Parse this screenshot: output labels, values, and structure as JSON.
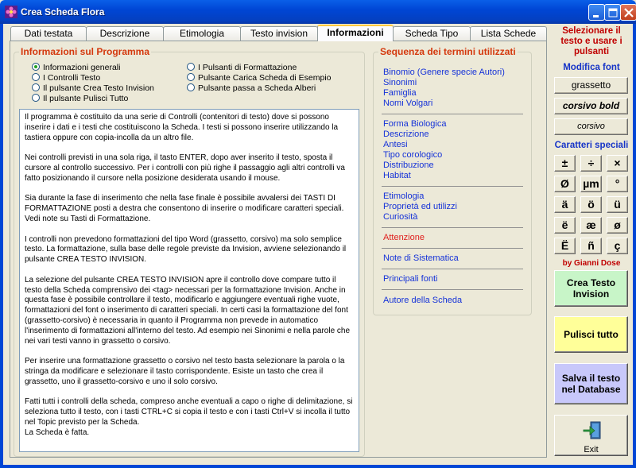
{
  "window": {
    "title": "Crea Scheda Flora"
  },
  "tabs": [
    {
      "label": "Dati testata"
    },
    {
      "label": "Descrizione"
    },
    {
      "label": "Etimologia"
    },
    {
      "label": "Testo invision"
    },
    {
      "label": "Informazioni"
    },
    {
      "label": "Scheda Tipo"
    },
    {
      "label": "Lista Schede"
    }
  ],
  "active_tab": "Informazioni",
  "info": {
    "group_title": "Informazioni sul Programma",
    "options": [
      {
        "label": "Informazioni generali",
        "checked": true
      },
      {
        "label": "I Controlli Testo",
        "checked": false
      },
      {
        "label": "Il pulsante Crea Testo Invision",
        "checked": false
      },
      {
        "label": "Il pulsante Pulisci Tutto",
        "checked": false
      },
      {
        "label": "I Pulsanti di Formattazione",
        "checked": false
      },
      {
        "label": "Pulsante Carica Scheda di Esempio",
        "checked": false
      },
      {
        "label": "Pulsante passa a Scheda Alberi",
        "checked": false
      }
    ],
    "paragraphs": [
      "Il programma è costituito da una serie di Controlli (contenitori di testo) dove si possono inserire i dati e i testi che costituiscono la Scheda. I testi si possono inserire utilizzando la tastiera oppure con copia-incolla da un altro file.",
      "Nei controlli previsti in una sola riga, il tasto ENTER, dopo aver inserito il testo, sposta il cursore al controllo successivo. Per i controlli con più righe il passaggio agli altri controlli va fatto posizionando il cursore nella posizione desiderata usando il mouse.",
      "Sia durante la fase di inserimento che nella fase finale è possibile avvalersi dei TASTI DI FORMATTAZIONE posti a destra che consentono di inserire o modificare caratteri speciali. Vedi note su Tasti di Formattazione.",
      "I controlli non prevedono formattazioni del tipo Word (grassetto, corsivo) ma solo semplice testo. La formattazione, sulla base delle regole previste da Invision, avviene selezionando il pulsante CREA TESTO INVISION.",
      "La selezione del pulsante CREA TESTO INVISION apre il controllo dove compare tutto il testo della Scheda comprensivo dei <tag> necessari per la formattazione Invision. Anche in questa fase è possibile controllare il testo, modificarlo e aggiungere eventuali righe vuote, formattazioni del font o inserimento di caratteri speciali. In certi casi la formattazione del font (grassetto-corsivo) è necessaria in quanto il Programma non prevede in automatico l'inserimento di formattazioni all'interno del testo. Ad esempio nei Sinonimi e nella parole che nei vari testi vanno in grassetto o corsivo.",
      "Per inserire una formattazione grassetto o corsivo nel testo basta selezionare la parola o la stringa da modificare e selezionare il tasto corrispondente. Esiste un tasto che crea il grassetto, uno il grassetto-corsivo e uno il solo corsivo.",
      "Fatti tutti i controlli della scheda, compreso anche eventuali a capo o righe di delimitazione, si seleziona tutto il testo, con i tasti CTRL+C si copia il testo e con i tasti Ctrl+V si incolla il tutto nel Topic previsto per la Scheda.\nLa Scheda è fatta."
    ]
  },
  "sequence": {
    "title": "Sequenza dei termini utilizzati",
    "groups": [
      [
        "Binomio (Genere specie Autori)",
        "Sinonimi",
        "Famiglia",
        "Nomi Volgari"
      ],
      [
        "Forma Biologica",
        "Descrizione",
        "Antesi",
        "Tipo corologico",
        "Distribuzione",
        "Habitat"
      ],
      [
        "Etimologia",
        "Proprietà ed utilizzi",
        "Curiosità"
      ],
      [
        "Attenzione"
      ],
      [
        "Note di Sistematica"
      ],
      [
        "Principali fonti"
      ],
      [
        "Autore della Scheda"
      ]
    ]
  },
  "right_panel": {
    "instruction": "Selezionare il testo e usare i pulsanti",
    "modify_font": "Modifica font",
    "font_buttons": [
      "grassetto",
      "corsivo bold",
      "corsivo"
    ],
    "special_chars_title": "Caratteri speciali",
    "special_chars": [
      "±",
      "÷",
      "×",
      "Ø",
      "µm",
      "°",
      "ä",
      "ö",
      "ü",
      "ë",
      "æ",
      "ø",
      "Ë",
      "ñ",
      "ç"
    ],
    "author": "by Gianni Dose",
    "create_button": "Crea Testo Invision",
    "clear_button": "Pulisci tutto",
    "save_button": "Salva il testo nel Database",
    "exit_button": "Exit"
  },
  "colors": {
    "accent_red": "#D4380D",
    "link_blue": "#1532D8",
    "create_green": "#C8F5C8",
    "clear_yellow": "#FFFF99",
    "save_lavender": "#C8C8FA"
  }
}
